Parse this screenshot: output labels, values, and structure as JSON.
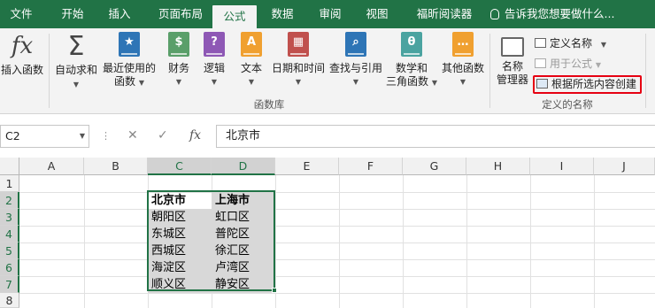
{
  "tabs": [
    "文件",
    "开始",
    "插入",
    "页面布局",
    "公式",
    "数据",
    "审阅",
    "视图",
    "福昕阅读器"
  ],
  "active_tab": "公式",
  "tell_me": "告诉我您想要做什么...",
  "ribbon": {
    "insert_function": "插入函数",
    "autosum": "自动求和",
    "recent_l1": "最近使用的",
    "recent_l2": "函数",
    "financial": "财务",
    "logical": "逻辑",
    "text": "文本",
    "datetime": "日期和时间",
    "lookup": "查找与引用",
    "math_l1": "数学和",
    "math_l2": "三角函数",
    "more": "其他函数",
    "group_library": "函数库",
    "name_manager_l1": "名称",
    "name_manager_l2": "管理器",
    "define_name": "定义名称",
    "use_in_formula": "用于公式",
    "create_from_selection": "根据所选内容创建",
    "group_defined_names": "定义的名称"
  },
  "formula_bar": {
    "name_box": "C2",
    "content": "北京市"
  },
  "columns": [
    "A",
    "B",
    "C",
    "D",
    "E",
    "F",
    "G",
    "H",
    "I",
    "J"
  ],
  "rows": [
    "1",
    "2",
    "3",
    "4",
    "5",
    "6",
    "7",
    "8"
  ],
  "cells": {
    "C2": "北京市",
    "D2": "上海市",
    "C3": "朝阳区",
    "D3": "虹口区",
    "C4": "东城区",
    "D4": "普陀区",
    "C5": "西城区",
    "D5": "徐汇区",
    "C6": "海淀区",
    "D6": "卢湾区",
    "C7": "顺义区",
    "D7": "静安区"
  },
  "colors": {
    "accent": "#217346",
    "highlight_box": "#e60012"
  }
}
